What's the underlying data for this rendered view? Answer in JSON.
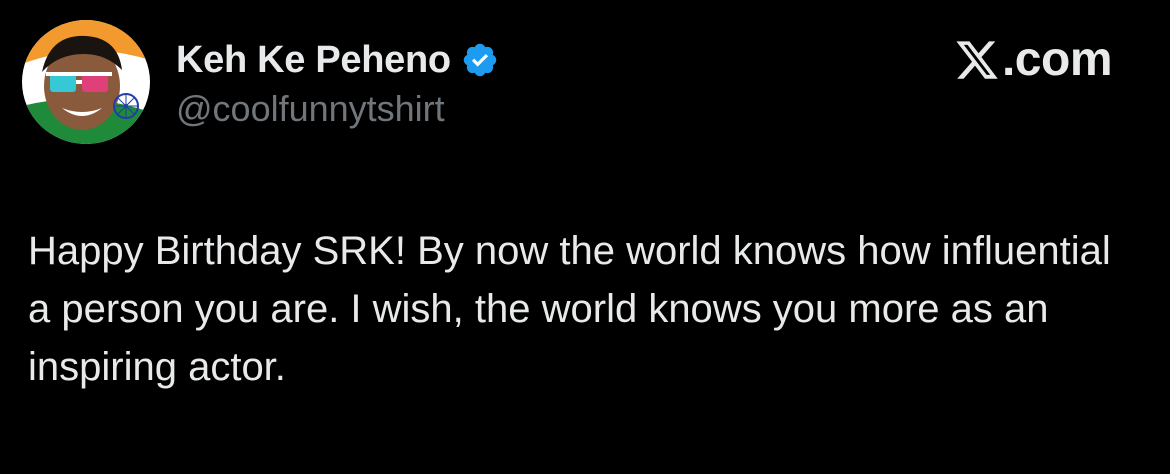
{
  "author": {
    "display_name": "Keh Ke Peheno",
    "handle": "@coolfunnytshirt",
    "verified": true,
    "avatar_icon": "profile-avatar"
  },
  "brand": {
    "logo_icon": "x-logo-icon",
    "text": ".com"
  },
  "tweet": {
    "text": "Happy Birthday SRK! By now the world knows how influential a person you are. I wish, the world knows you more as an inspiring actor."
  },
  "colors": {
    "background": "#000000",
    "text": "#e7e9ea",
    "secondary_text": "#71767b",
    "verified_badge": "#1d9bf0",
    "flag_saffron": "#f29a2e",
    "flag_green": "#1f8a3a"
  }
}
